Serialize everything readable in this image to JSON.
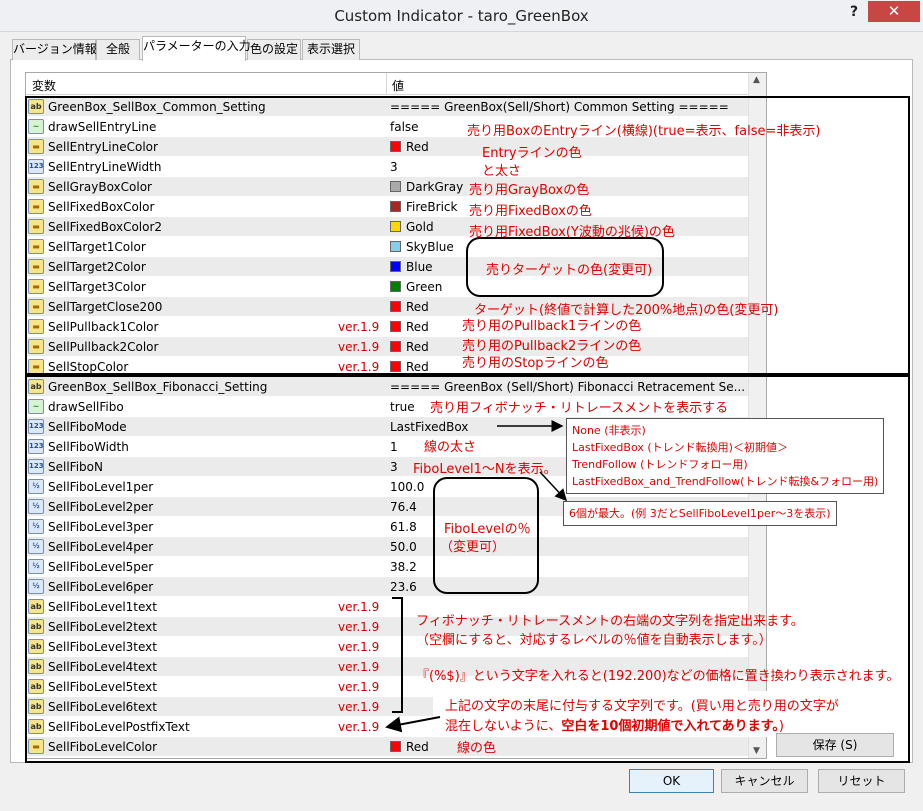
{
  "window": {
    "title": "Custom Indicator - taro_GreenBox",
    "help": "?",
    "close": "✕"
  },
  "tabs": [
    {
      "label": "バージョン情報"
    },
    {
      "label": "全般"
    },
    {
      "label": "パラメーターの入力"
    },
    {
      "label": "色の設定"
    },
    {
      "label": "表示選択"
    }
  ],
  "grid": {
    "col_variable": "変数",
    "col_value": "値"
  },
  "rows": [
    {
      "icon": "ab",
      "name": "GreenBox_SellBox_Common_Setting",
      "value": "===== GreenBox(Sell/Short) Common Setting ====="
    },
    {
      "icon": "bool",
      "name": "drawSellEntryLine",
      "value": "false"
    },
    {
      "icon": "color",
      "name": "SellEntryLineColor",
      "value": "Red",
      "swatch": "#ff0000"
    },
    {
      "icon": "int",
      "name": "SellEntryLineWidth",
      "value": "3"
    },
    {
      "icon": "color",
      "name": "SellGrayBoxColor",
      "value": "DarkGray",
      "swatch": "#a9a9a9"
    },
    {
      "icon": "color",
      "name": "SellFixedBoxColor",
      "value": "FireBrick",
      "swatch": "#b22222"
    },
    {
      "icon": "color",
      "name": "SellFixedBoxColor2",
      "value": "Gold",
      "swatch": "#ffd700"
    },
    {
      "icon": "color",
      "name": "SellTarget1Color",
      "value": "SkyBlue",
      "swatch": "#87ceeb"
    },
    {
      "icon": "color",
      "name": "SellTarget2Color",
      "value": "Blue",
      "swatch": "#0000ff"
    },
    {
      "icon": "color",
      "name": "SellTarget3Color",
      "value": "Green",
      "swatch": "#008000"
    },
    {
      "icon": "color",
      "name": "SellTargetClose200",
      "value": "Red",
      "swatch": "#ff0000"
    },
    {
      "icon": "color",
      "name": "SellPullback1Color",
      "ver": "ver.1.9",
      "value": "Red",
      "swatch": "#ff0000"
    },
    {
      "icon": "color",
      "name": "SellPullback2Color",
      "ver": "ver.1.9",
      "value": "Red",
      "swatch": "#ff0000"
    },
    {
      "icon": "color",
      "name": "SellStopColor",
      "ver": "ver.1.9",
      "value": "Red",
      "swatch": "#ff0000"
    },
    {
      "icon": "ab",
      "name": "GreenBox_SellBox_Fibonacci_Setting",
      "value": "===== GreenBox (Sell/Short) Fibonacci Retracement Se..."
    },
    {
      "icon": "bool",
      "name": "drawSellFibo",
      "value": "true"
    },
    {
      "icon": "int",
      "name": "SellFiboMode",
      "value": "LastFixedBox"
    },
    {
      "icon": "int",
      "name": "SellFiboWidth",
      "value": "1"
    },
    {
      "icon": "int",
      "name": "SellFiboN",
      "value": "3"
    },
    {
      "icon": "dbl",
      "name": "SellFiboLevel1per",
      "value": "100.0"
    },
    {
      "icon": "dbl",
      "name": "SellFiboLevel2per",
      "value": "76.4"
    },
    {
      "icon": "dbl",
      "name": "SellFiboLevel3per",
      "value": "61.8"
    },
    {
      "icon": "dbl",
      "name": "SellFiboLevel4per",
      "value": "50.0"
    },
    {
      "icon": "dbl",
      "name": "SellFiboLevel5per",
      "value": "38.2"
    },
    {
      "icon": "dbl",
      "name": "SellFiboLevel6per",
      "value": "23.6"
    },
    {
      "icon": "ab",
      "name": "SellFiboLevel1text",
      "ver": "ver.1.9",
      "value": ""
    },
    {
      "icon": "ab",
      "name": "SellFiboLevel2text",
      "ver": "ver.1.9",
      "value": ""
    },
    {
      "icon": "ab",
      "name": "SellFiboLevel3text",
      "ver": "ver.1.9",
      "value": ""
    },
    {
      "icon": "ab",
      "name": "SellFiboLevel4text",
      "ver": "ver.1.9",
      "value": ""
    },
    {
      "icon": "ab",
      "name": "SellFiboLevel5text",
      "ver": "ver.1.9",
      "value": ""
    },
    {
      "icon": "ab",
      "name": "SellFiboLevel6text",
      "ver": "ver.1.9",
      "value": ""
    },
    {
      "icon": "ab",
      "name": "SellFiboLevelPostfixText",
      "ver": "ver.1.9",
      "value": ""
    },
    {
      "icon": "color",
      "name": "SellFiboLevelColor",
      "value": "Red",
      "swatch": "#ff0000"
    }
  ],
  "annotations": {
    "entry_line": "売り用BoxのEntryライン(横線)(true=表示、false=非表示)",
    "entry_color": "Entryラインの色",
    "entry_width": "と太さ",
    "graybox": "売り用GrayBoxの色",
    "fixedbox": "売り用FixedBoxの色",
    "fixedbox2": "売り用FixedBox(Y波動の兆候)の色",
    "target": "売りターゲットの色(変更可)",
    "target200": "ターゲット(終値で計算した200%地点)の色(変更可)",
    "pullback1": "売り用のPullback1ラインの色",
    "pullback2": "売り用のPullback2ラインの色",
    "stop": "売り用のStopラインの色",
    "draw_fibo": "売り用フィボナッチ・リトレースメントを表示する",
    "fibo_width": "線の太さ",
    "fibo_n": "FiboLevel1～Nを表示。",
    "fibo_level_pct": "FiboLevelの％",
    "fibo_level_changeable": "（変更可）",
    "text_line1": "フィボナッチ・リトレースメントの右端の文字列を指定出来ます。",
    "text_line2": "（空欄にすると、対応するレベルの％値を自動表示します。）",
    "text_line3": "『(%$)』という文字を入れると(192.200)などの価格に置き換わり表示されます。",
    "postfix_line1": "上記の文字の末尾に付与する文字列です。(買い用と売り用の文字が",
    "postfix_line2a": "混在しないように、",
    "postfix_line2b": "空白を10個初期値で入れてあります。",
    "postfix_line2c": ")",
    "level_color": "線の色"
  },
  "mode_popup": {
    "items": [
      "None (非表示)",
      "LastFixedBox (トレンド転換用)＜初期値＞",
      "TrendFollow (トレンドフォロー用)",
      "LastFixedBox_and_TrendFollow(トレンド転換&フォロー用)"
    ]
  },
  "max_popup": {
    "text": "6個が最大。(例 3だとSellFiboLevel1per～3を表示)"
  },
  "buttons": {
    "save": "保存 (S)",
    "ok": "OK",
    "cancel": "キャンセル",
    "reset": "リセット"
  }
}
